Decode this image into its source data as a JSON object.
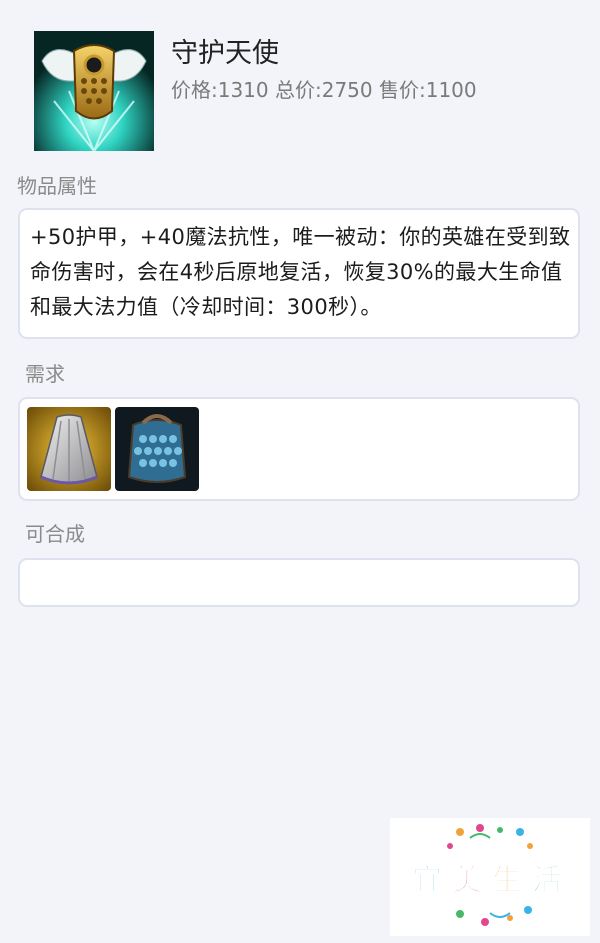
{
  "item": {
    "name": "守护天使",
    "prices": "价格:1310 总价:2750 售价:1100",
    "icon": "guardian-angel-item-icon"
  },
  "sections": {
    "attributes": {
      "label": "物品属性",
      "text": "+50护甲，+40魔法抗性，唯一被动：你的英雄在受到致命伤害时，会在4秒后原地复活，恢复30%的最大生命值和最大法力值（冷却时间：300秒）。"
    },
    "requirements": {
      "label": "需求",
      "items": [
        {
          "icon": "cloak-item-icon"
        },
        {
          "icon": "chain-vest-item-icon"
        }
      ]
    },
    "builds_into": {
      "label": "可合成"
    }
  },
  "watermark": {
    "text": "宜美生活",
    "chars": [
      "宜",
      "美",
      "生",
      "活"
    ],
    "colors": [
      "#3bb3e6",
      "#e0478f",
      "#f2a23a",
      "#47b86a"
    ]
  }
}
